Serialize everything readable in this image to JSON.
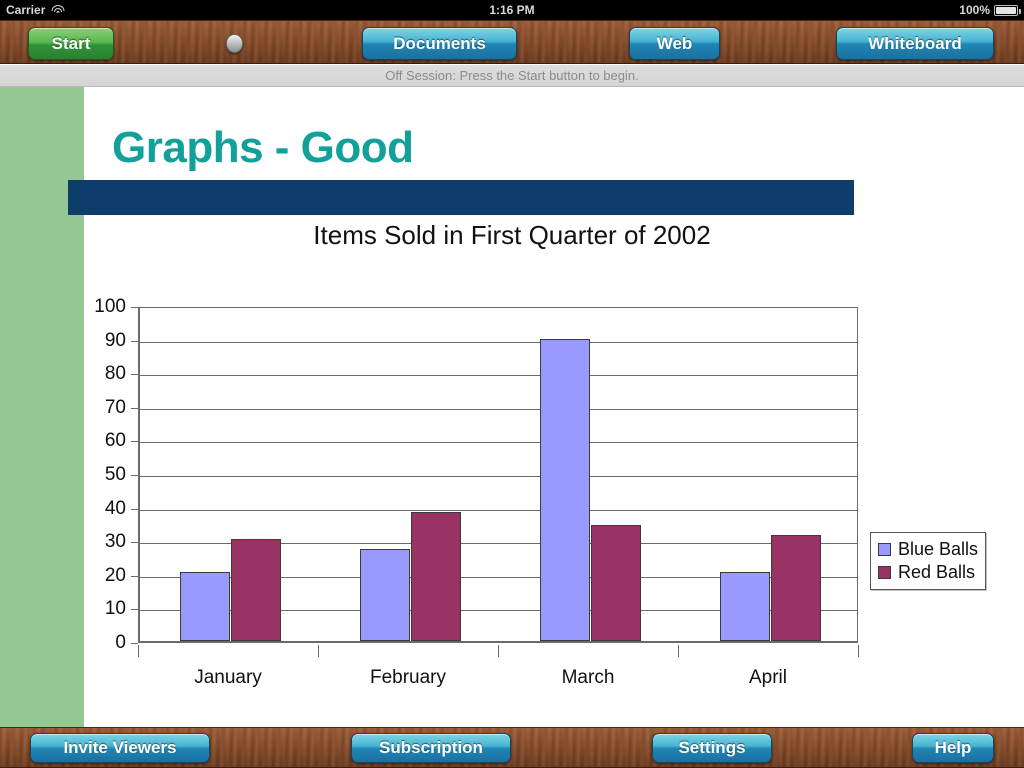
{
  "status_bar": {
    "carrier": "Carrier",
    "wifi_icon": "wifi-icon",
    "time": "1:16 PM",
    "battery_percent": "100%",
    "battery_icon": "battery-full-icon"
  },
  "top_toolbar": {
    "start_label": "Start",
    "indicator_icon": "status-led-icon",
    "documents_label": "Documents",
    "web_label": "Web",
    "whiteboard_label": "Whiteboard"
  },
  "session": {
    "status_text": "Off Session: Press the Start button to begin."
  },
  "slide": {
    "title": "Graphs - Good",
    "title_color": "#12a09a",
    "band_color": "#0d3d6b",
    "rail_color": "#94c791"
  },
  "bottom_toolbar": {
    "invite_label": "Invite Viewers",
    "subscription_label": "Subscription",
    "settings_label": "Settings",
    "help_label": "Help"
  },
  "chart_data": {
    "type": "bar",
    "title": "Items Sold in First Quarter of 2002",
    "xlabel": "",
    "ylabel": "",
    "categories": [
      "January",
      "February",
      "March",
      "April"
    ],
    "series": [
      {
        "name": "Blue Balls",
        "color": "#9999ff",
        "values": [
          20.5,
          27.5,
          90,
          20.5
        ]
      },
      {
        "name": "Red Balls",
        "color": "#993366",
        "values": [
          30.5,
          38.5,
          34.5,
          31.5
        ]
      }
    ],
    "ylim": [
      0,
      100
    ],
    "yticks": [
      0,
      10,
      20,
      30,
      40,
      50,
      60,
      70,
      80,
      90,
      100
    ],
    "ytick_labels": [
      "0",
      "10",
      "20",
      "30",
      "40",
      "50",
      "60",
      "70",
      "80",
      "90",
      "100"
    ],
    "grid": true,
    "legend_position": "right"
  }
}
